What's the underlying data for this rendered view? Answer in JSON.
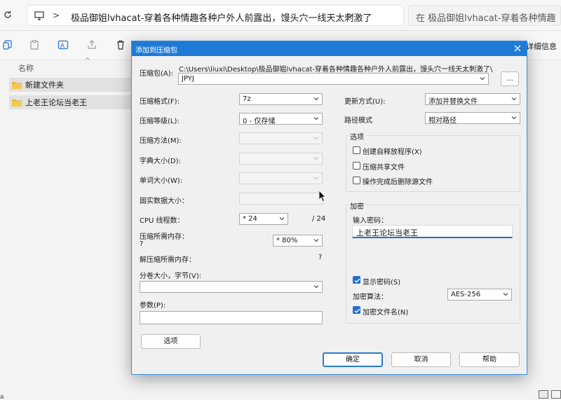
{
  "explorer": {
    "breadcrumb_sep": ">",
    "breadcrumb_current": "极品御姐lvhacat-穿着各种情趣各种户外人前露出，馒头穴一线天太刺激了",
    "breadcrumb_sep2": ">",
    "search_placeholder": "在 极品御姐lvhacat-穿着各种情趣",
    "details_label": "详细信息",
    "column_name": "名称",
    "sort_indicator": "^",
    "files": [
      "新建文件夹",
      "上老王论坛当老王"
    ],
    "status_left": "a"
  },
  "dialog": {
    "title": "添加到压缩包",
    "archive_label": "压缩包(A):",
    "archive_path": "C:\\Users\\liuxi\\Desktop\\极品御姐lvhacat-穿着各种情趣各种户外人前露出，馒头穴一线天太刺激了\\",
    "archive_name": "JPYJ",
    "browse_button": "...",
    "format_label": "压缩格式(F):",
    "format_value": "7z",
    "level_label": "压缩等级(L):",
    "level_value": "0 - 仅存储",
    "method_label": "压缩方法(M):",
    "dict_label": "字典大小(D):",
    "word_label": "单词大小(W):",
    "solid_label": "固实数据大小：",
    "cpu_label": "CPU 线程数：",
    "cpu_value": "* 24",
    "cpu_total": "/ 24",
    "mem_comp_label": "压缩所需内存：",
    "mem_comp_value": "?",
    "mem_percent": "* 80%",
    "mem_decomp_label": "解压缩所需内存：",
    "mem_decomp_value": "?",
    "split_label": "分卷大小，字节(V):",
    "params_label": "参数(P):",
    "options_button": "选项",
    "update_label": "更新方式(U):",
    "update_value": "添加并替换文件",
    "pathmode_label": "路径模式",
    "pathmode_value": "相对路径",
    "options_group": "选项",
    "opt_sfx": "创建自释放程序(X)",
    "opt_shared": "压缩共享文件",
    "opt_delete": "操作完成后删除源文件",
    "encrypt_group": "加密",
    "password_label": "输入密码：",
    "password_value": "上老王论坛当老王",
    "show_password": "显示密码(S)",
    "enc_method_label": "加密算法：",
    "enc_method_value": "AES-256",
    "encrypt_names": "加密文件名(N)",
    "ok_button": "确定",
    "cancel_button": "取消",
    "help_button": "帮助"
  },
  "colors": {
    "accent": "#1e7ad6",
    "checkbox": "#1f6fce"
  }
}
